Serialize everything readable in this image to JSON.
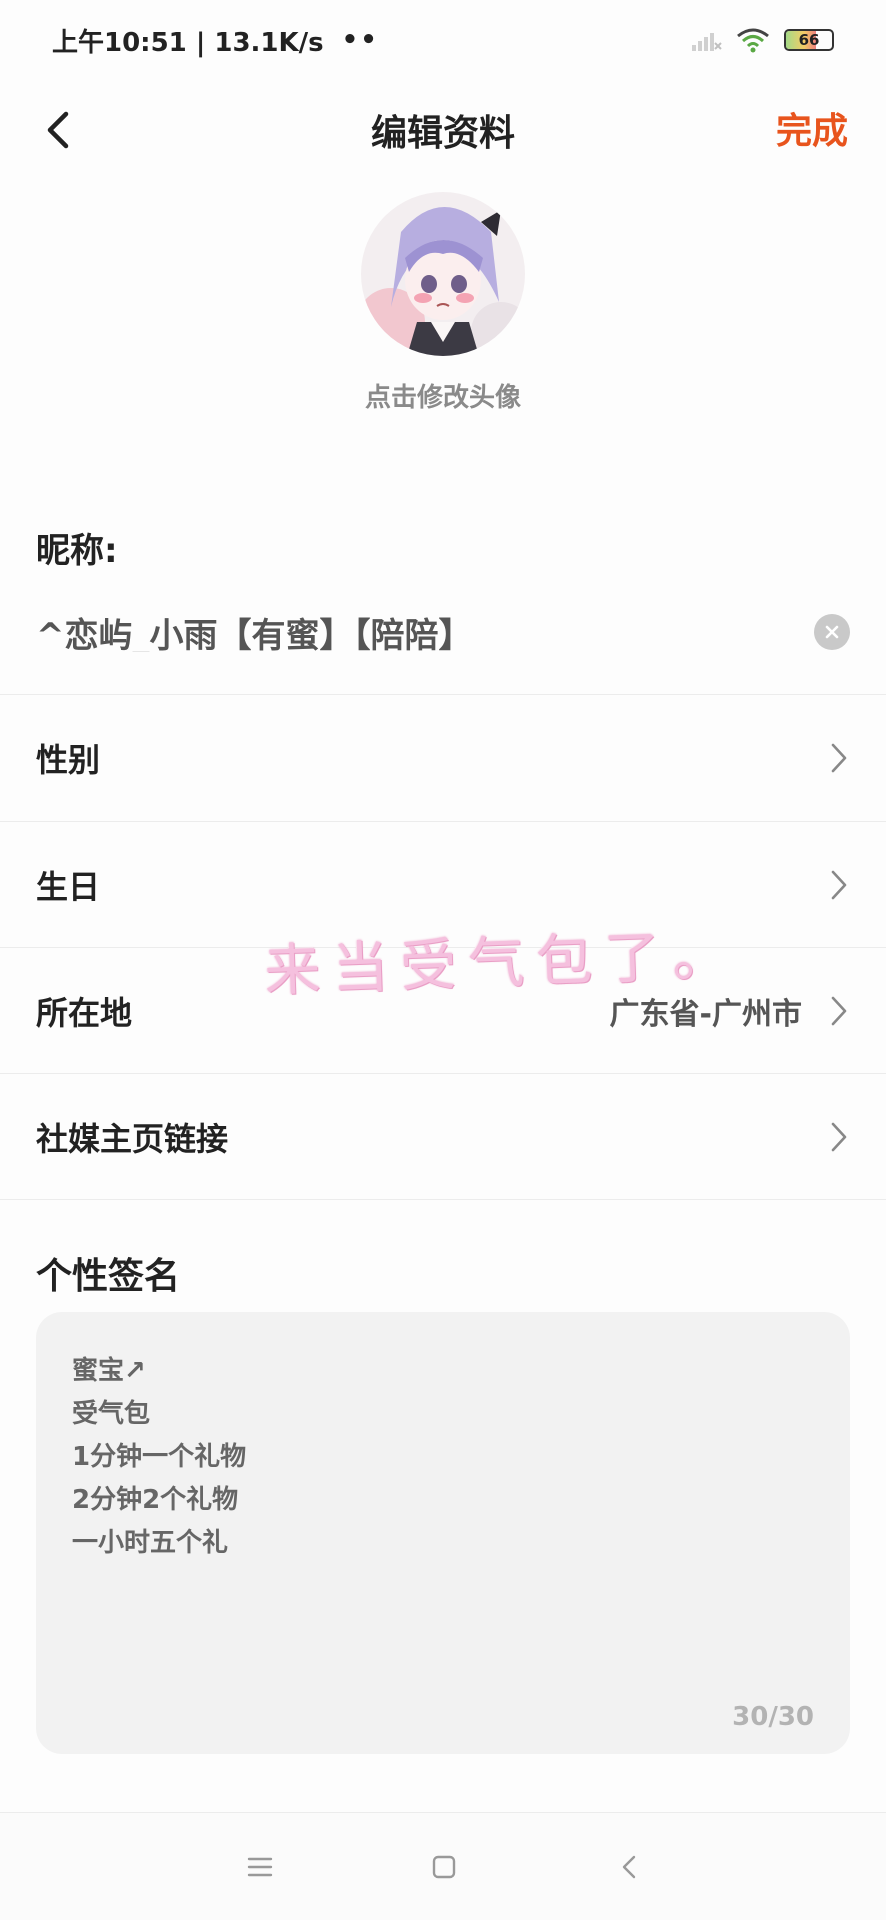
{
  "status_bar": {
    "time_speed": "上午10:51 | 13.1K/s",
    "dots": "••",
    "battery": "66"
  },
  "nav": {
    "title": "编辑资料",
    "done": "完成"
  },
  "avatar": {
    "hint": "点击修改头像"
  },
  "nickname": {
    "label": "昵称:",
    "value": "^恋屿_小雨【有蜜】【陪陪】"
  },
  "rows": {
    "gender": {
      "label": "性别"
    },
    "birthday": {
      "label": "生日"
    },
    "location": {
      "label": "所在地",
      "value": "广东省-广州市"
    },
    "social": {
      "label": "社媒主页链接"
    }
  },
  "watermark": "来当受气包了。",
  "signature": {
    "title": "个性签名",
    "lines": [
      "蜜宝↗",
      "受气包",
      "1分钟一个礼物",
      "2分钟2个礼物",
      "一小时五个礼"
    ],
    "counter": "30/30"
  },
  "colors": {
    "accent": "#e8541d",
    "sig_bg": "#f2f2f2",
    "watermark": "#f5c0de"
  },
  "icons": {
    "back": "chevron-left-icon",
    "clear": "close-circle-icon",
    "chevron": "chevron-right-icon",
    "menu": "menu-icon",
    "home": "square-icon",
    "nav_back": "triangle-left-icon"
  }
}
